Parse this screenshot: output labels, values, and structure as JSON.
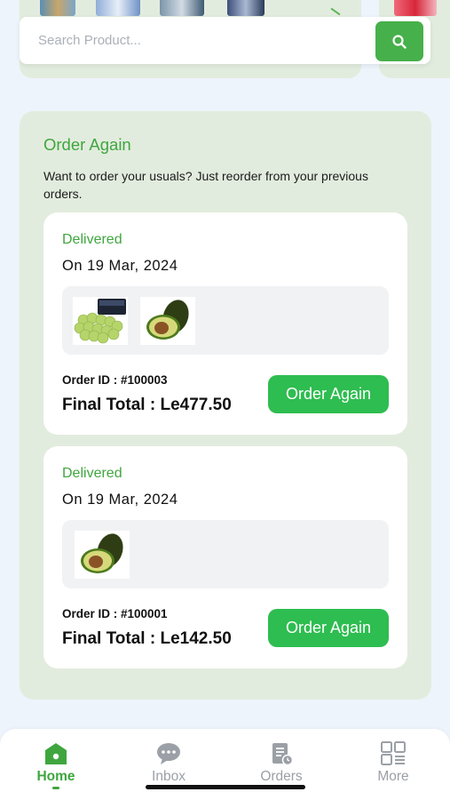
{
  "search": {
    "placeholder": "Search Product..."
  },
  "order_again": {
    "title": "Order Again",
    "description": "Want to order your usuals? Just reorder from your previous orders.",
    "orders": [
      {
        "status": "Delivered",
        "date": "On 19 Mar, 2024",
        "products": [
          "grapes",
          "avocado"
        ],
        "order_id": "Order ID : #100003",
        "final_total": "Final Total : Le477.50",
        "button_label": "Order Again"
      },
      {
        "status": "Delivered",
        "date": "On 19 Mar, 2024",
        "products": [
          "avocado"
        ],
        "order_id": "Order ID : #100001",
        "final_total": "Final Total : Le142.50",
        "button_label": "Order Again"
      }
    ]
  },
  "bottom_nav": {
    "items": [
      {
        "label": "Home",
        "icon": "home-icon",
        "active": true
      },
      {
        "label": "Inbox",
        "icon": "chat-icon",
        "active": false
      },
      {
        "label": "Orders",
        "icon": "orders-icon",
        "active": false
      },
      {
        "label": "More",
        "icon": "grid-icon",
        "active": false
      }
    ]
  },
  "colors": {
    "accent": "#3fa63f",
    "button": "#2ebd50",
    "section_bg": "#e2ecde",
    "page_bg": "#eef4fb"
  }
}
